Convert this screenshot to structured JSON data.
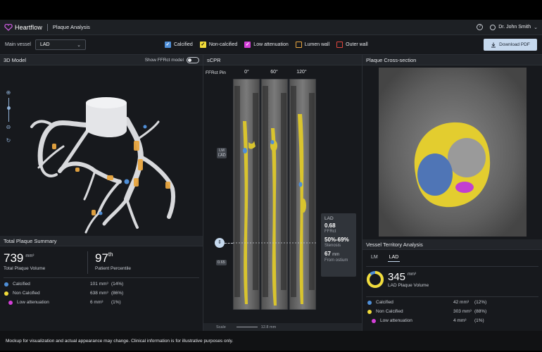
{
  "header": {
    "brand": "Heartflow",
    "page_title": "Plaque Analysis",
    "help_symbol": "?",
    "user_name": "Dr. John Smith"
  },
  "toolbar": {
    "main_vessel_label": "Main vessel",
    "main_vessel_value": "LAD",
    "legend": [
      {
        "label": "Calcified",
        "color": "#4f8fd8",
        "checked": true
      },
      {
        "label": "Non-calcified",
        "color": "#f2dc3a",
        "checked": true
      },
      {
        "label": "Low attenuation",
        "color": "#d43fd8",
        "checked": true
      },
      {
        "label": "Lumen wall",
        "color": "#e8a640",
        "checked": false
      },
      {
        "label": "Outer wall",
        "color": "#e0463e",
        "checked": false
      }
    ],
    "download_label": "Download PDF"
  },
  "model_panel": {
    "title": "3D Model",
    "ffr_toggle_label": "Show FFRct model",
    "ffr_toggle_on": false
  },
  "scpr_panel": {
    "title": "sCPR",
    "pin_label": "FFRct Pin",
    "angles": [
      "0°",
      "60°",
      "120°"
    ],
    "marker_lm": "LM",
    "marker_lad": "LAD",
    "marker_value": "0.65",
    "scale_label": "Scale",
    "scale_value": "12.8 mm",
    "callout": {
      "vessel": "LAD",
      "ffr_value": "0.68",
      "ffr_label": "FFRct",
      "stenosis_value": "50%-69%",
      "stenosis_label": "Stenosis",
      "distance_value": "67",
      "distance_unit": "mm",
      "distance_label": "From ostium"
    }
  },
  "cross_section_panel": {
    "title": "Plaque Cross-section"
  },
  "total_summary": {
    "title": "Total Plaque Summary",
    "volume_value": "739",
    "volume_unit": "mm³",
    "volume_label": "Total Plaque Volume",
    "percentile_value": "97",
    "percentile_suffix": "th",
    "percentile_label": "Patient Percentile",
    "rows": [
      {
        "label": "Calcified",
        "value": "101 mm³",
        "pct": "(14%)",
        "color": "#4f8fd8"
      },
      {
        "label": "Non Calcified",
        "value": "638 mm³",
        "pct": "(86%)",
        "color": "#f2dc3a"
      },
      {
        "label": "Low attenuation",
        "value": "6 mm³",
        "pct": "(1%)",
        "color": "#d43fd8"
      }
    ]
  },
  "territory": {
    "title": "Vessel Territory Analysis",
    "tabs": [
      "LM",
      "LAD"
    ],
    "active_tab": "LAD",
    "volume_value": "345",
    "volume_unit": "mm³",
    "volume_label": "LAD Plaque Volume",
    "ring_fraction": 0.88,
    "rows": [
      {
        "label": "Calcified",
        "value": "42 mm³",
        "pct": "(12%)",
        "color": "#4f8fd8"
      },
      {
        "label": "Non Calcified",
        "value": "303 mm³",
        "pct": "(88%)",
        "color": "#f2dc3a"
      },
      {
        "label": "Low attenuation",
        "value": "4 mm³",
        "pct": "(1%)",
        "color": "#d43fd8"
      }
    ]
  },
  "footer": {
    "disclaimer": "Mockup for visualization and actual appearance may change. Clinical information is for illustrative purposes only."
  }
}
